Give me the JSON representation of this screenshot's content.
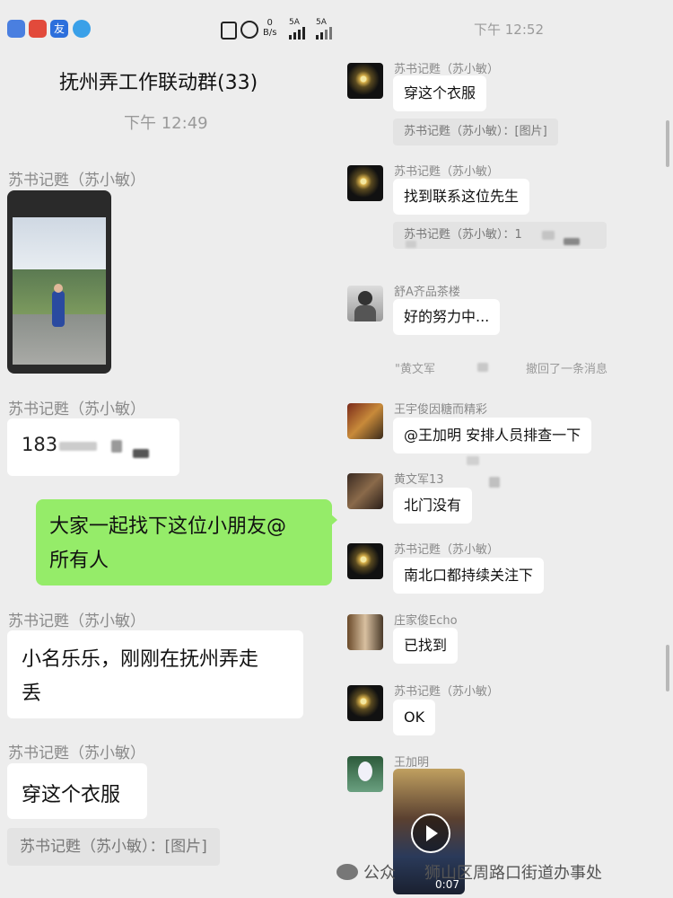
{
  "status_bar": {
    "net_speed": "0",
    "net_unit": "B/s",
    "signal1": "5A",
    "signal2": "5A",
    "right_time": "下午 12:52"
  },
  "left": {
    "group_title": "抚州弄工作联动群(33)",
    "time": "下午 12:49",
    "messages": [
      {
        "sender": "苏书记甦（苏小敏）",
        "type": "image"
      },
      {
        "sender": "苏书记甦（苏小敏）",
        "text": "183"
      },
      {
        "self": true,
        "text_line1": "大家一起找下这位小朋友@",
        "text_line2": "所有人"
      },
      {
        "sender": "苏书记甦（苏小敏）",
        "text_line1": "小名乐乐，刚刚在抚州弄走",
        "text_line2": "丢"
      },
      {
        "sender": "苏书记甦（苏小敏）",
        "text": "穿这个衣服",
        "quote": "苏书记甦（苏小敏）：[图片]"
      }
    ]
  },
  "right": {
    "messages": [
      {
        "sender": "苏书记甦（苏小敏）",
        "text": "穿这个衣服",
        "quote": "苏书记甦（苏小敏）：[图片]"
      },
      {
        "sender": "苏书记甦（苏小敏）",
        "text": "找到联系这位先生",
        "quote": "苏书记甦（苏小敏）：1"
      },
      {
        "sender": "舒A齐品茶楼",
        "text": "好的努力中..."
      },
      {
        "system_left": "\"黄文军",
        "system_right": "撤回了一条消息"
      },
      {
        "sender": "王宇俊因糖而精彩",
        "text": "@王加明 安排人员排查一下"
      },
      {
        "sender": "黄文军13",
        "text": "北门没有"
      },
      {
        "sender": "苏书记甦（苏小敏）",
        "text": "南北口都持续关注下"
      },
      {
        "sender": "庄家俊Echo",
        "text": "已找到"
      },
      {
        "sender": "苏书记甦（苏小敏）",
        "text": "OK"
      },
      {
        "sender": "王加明",
        "type": "video",
        "duration": "0:07"
      }
    ]
  },
  "watermark": {
    "prefix": "公众",
    "suffix": "狮山区周路口街道办事处"
  },
  "colors": {
    "background": "#ededed",
    "self_bubble": "#95ec69",
    "bubble": "#ffffff",
    "name_text": "#8a8a8a"
  }
}
